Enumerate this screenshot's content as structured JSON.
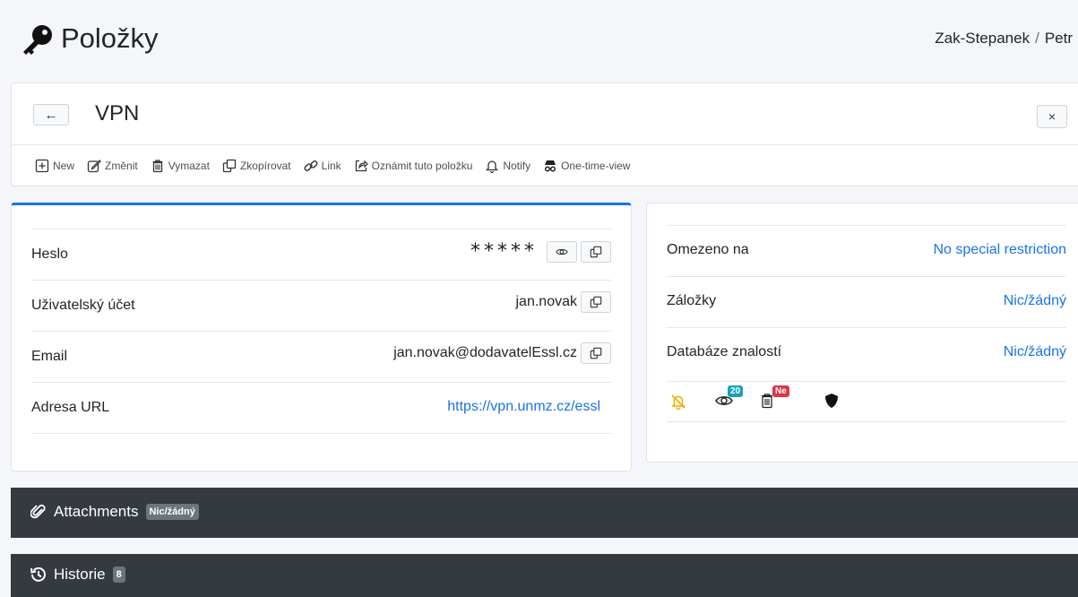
{
  "header": {
    "title": "Položky",
    "breadcrumb": [
      "Zak-Stepanek",
      "Petr"
    ],
    "breadcrumb_sep": "/"
  },
  "item": {
    "back_label": "←",
    "title": "VPN",
    "close_label": "×"
  },
  "toolbar": {
    "new": "New",
    "edit": "Změnit",
    "delete": "Vymazat",
    "copy": "Zkopírovat",
    "link": "Link",
    "announce": "Oznámit tuto položku",
    "notify": "Notify",
    "one_time_view": "One-time-view"
  },
  "fields": {
    "password": {
      "label": "Heslo",
      "value": "*****"
    },
    "user": {
      "label": "Uživatelský účet",
      "value": "jan.novak"
    },
    "email": {
      "label": "Email",
      "value": "jan.novak@dodavatelEssl.cz"
    },
    "url": {
      "label": "Adresa URL",
      "value": "https://vpn.unmz.cz/essl"
    }
  },
  "info": {
    "restricted": {
      "label": "Omezeno na",
      "value": "No special restriction"
    },
    "bookmarks": {
      "label": "Záložky",
      "value": "Nic/žádný"
    },
    "knowledge": {
      "label": "Databáze znalostí",
      "value": "Nic/žádný"
    },
    "views_badge": "20",
    "delete_badge": "Ne"
  },
  "attachments": {
    "title": "Attachments",
    "badge": "Nic/žádný"
  },
  "history": {
    "title": "Historie",
    "badge": "8"
  },
  "colors": {
    "accent": "#1a73e8",
    "dark_panel": "#343a40",
    "badge_teal": "#17a2b8",
    "badge_red": "#dc3545",
    "bell_yellow": "#f0ad00"
  }
}
